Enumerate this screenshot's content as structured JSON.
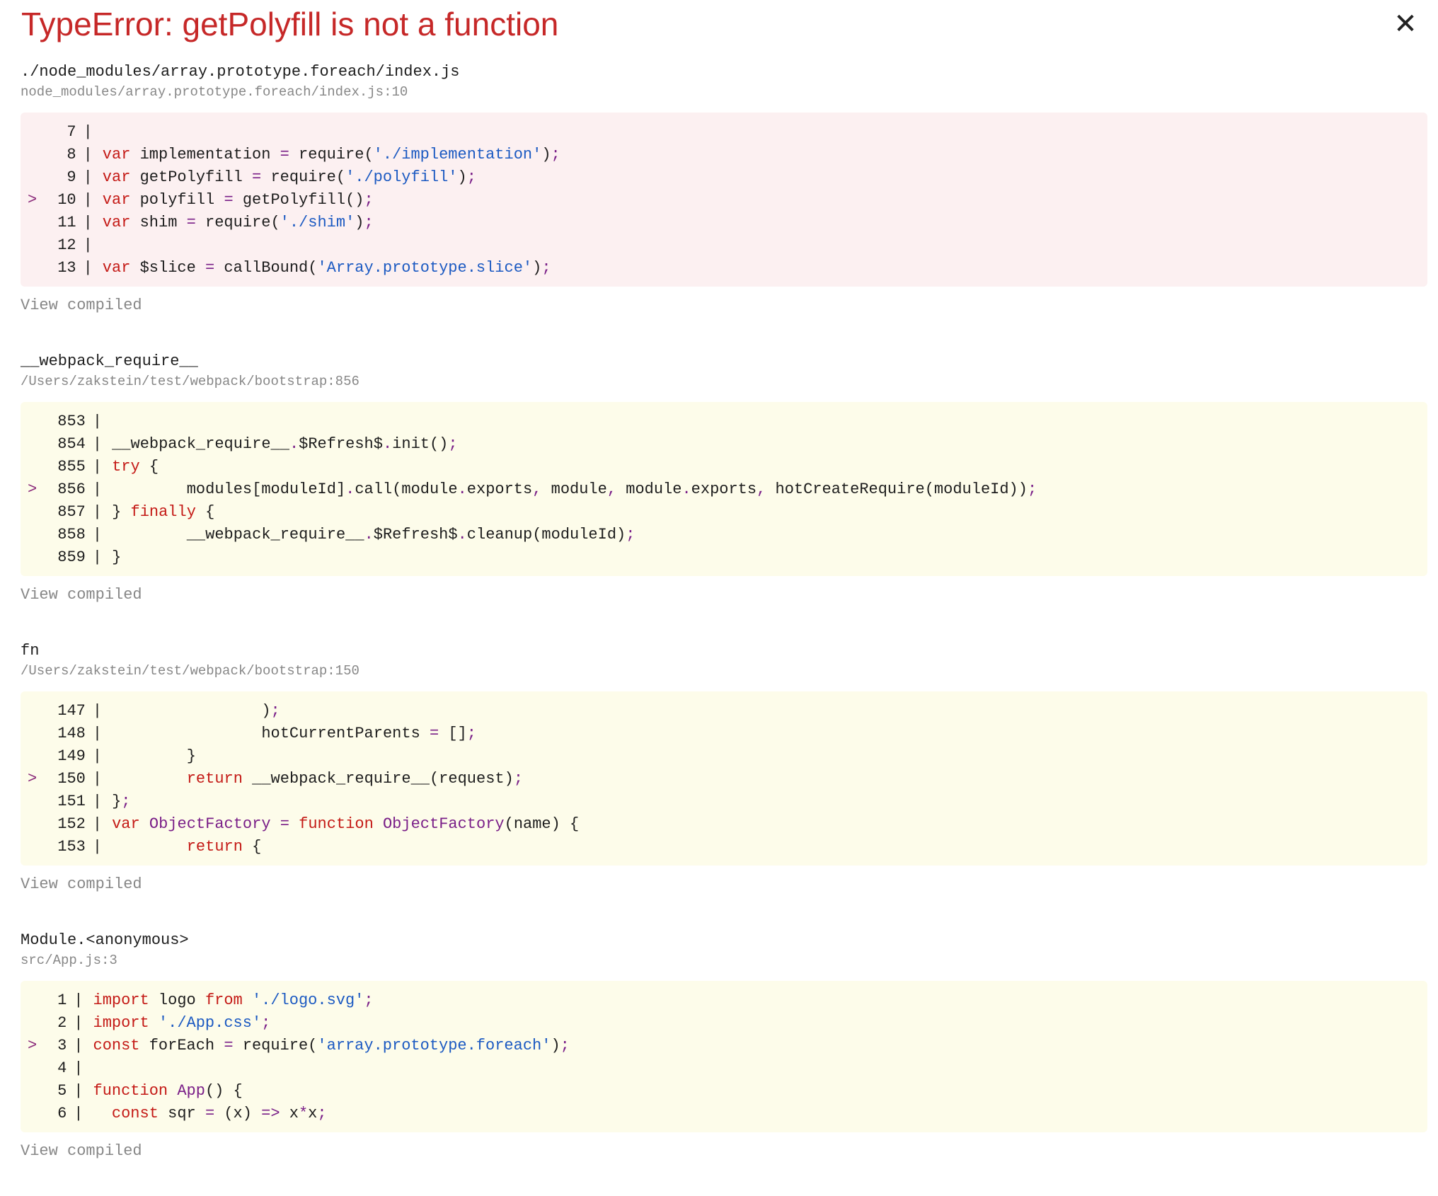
{
  "error": {
    "title": "TypeError: getPolyfill is not a function",
    "close_glyph": "✕"
  },
  "frames": [
    {
      "function": "./node_modules/array.prototype.foreach/index.js",
      "location": "node_modules/array.prototype.foreach/index.js:10",
      "style": "error",
      "view_compiled": "View compiled",
      "lines": [
        {
          "marker": "",
          "num": "7",
          "tokens": []
        },
        {
          "marker": "",
          "num": "8",
          "tokens": [
            [
              "kw",
              "var"
            ],
            [
              "txt",
              " implementation "
            ],
            [
              "punc",
              "="
            ],
            [
              "txt",
              " require("
            ],
            [
              "str",
              "'./implementation'"
            ],
            [
              "txt",
              ")"
            ],
            [
              "punc",
              ";"
            ]
          ]
        },
        {
          "marker": "",
          "num": "9",
          "tokens": [
            [
              "kw",
              "var"
            ],
            [
              "txt",
              " getPolyfill "
            ],
            [
              "punc",
              "="
            ],
            [
              "txt",
              " require("
            ],
            [
              "str",
              "'./polyfill'"
            ],
            [
              "txt",
              ")"
            ],
            [
              "punc",
              ";"
            ]
          ]
        },
        {
          "marker": ">",
          "num": "10",
          "tokens": [
            [
              "kw",
              "var"
            ],
            [
              "txt",
              " polyfill "
            ],
            [
              "punc",
              "="
            ],
            [
              "txt",
              " getPolyfill()"
            ],
            [
              "punc",
              ";"
            ]
          ]
        },
        {
          "marker": "",
          "num": "11",
          "tokens": [
            [
              "kw",
              "var"
            ],
            [
              "txt",
              " shim "
            ],
            [
              "punc",
              "="
            ],
            [
              "txt",
              " require("
            ],
            [
              "str",
              "'./shim'"
            ],
            [
              "txt",
              ")"
            ],
            [
              "punc",
              ";"
            ]
          ]
        },
        {
          "marker": "",
          "num": "12",
          "tokens": []
        },
        {
          "marker": "",
          "num": "13",
          "tokens": [
            [
              "kw",
              "var"
            ],
            [
              "txt",
              " $slice "
            ],
            [
              "punc",
              "="
            ],
            [
              "txt",
              " callBound("
            ],
            [
              "str",
              "'Array.prototype.slice'"
            ],
            [
              "txt",
              ")"
            ],
            [
              "punc",
              ";"
            ]
          ]
        }
      ]
    },
    {
      "function": "__webpack_require__",
      "location": "/Users/zakstein/test/webpack/bootstrap:856",
      "style": "warn",
      "view_compiled": "View compiled",
      "lines": [
        {
          "marker": "",
          "num": "853",
          "tokens": []
        },
        {
          "marker": "",
          "num": "854",
          "tokens": [
            [
              "txt",
              "__webpack_require__"
            ],
            [
              "punc",
              "."
            ],
            [
              "txt",
              "$Refresh$"
            ],
            [
              "punc",
              "."
            ],
            [
              "txt",
              "init()"
            ],
            [
              "punc",
              ";"
            ]
          ]
        },
        {
          "marker": "",
          "num": "855",
          "tokens": [
            [
              "kw",
              "try"
            ],
            [
              "txt",
              " {"
            ]
          ]
        },
        {
          "marker": ">",
          "num": "856",
          "tokens": [
            [
              "txt",
              "        modules[moduleId]"
            ],
            [
              "punc",
              "."
            ],
            [
              "txt",
              "call(module"
            ],
            [
              "punc",
              "."
            ],
            [
              "txt",
              "exports"
            ],
            [
              "punc",
              ","
            ],
            [
              "txt",
              " module"
            ],
            [
              "punc",
              ","
            ],
            [
              "txt",
              " module"
            ],
            [
              "punc",
              "."
            ],
            [
              "txt",
              "exports"
            ],
            [
              "punc",
              ","
            ],
            [
              "txt",
              " hotCreateRequire(moduleId))"
            ],
            [
              "punc",
              ";"
            ]
          ]
        },
        {
          "marker": "",
          "num": "857",
          "tokens": [
            [
              "txt",
              "} "
            ],
            [
              "kw",
              "finally"
            ],
            [
              "txt",
              " {"
            ]
          ]
        },
        {
          "marker": "",
          "num": "858",
          "tokens": [
            [
              "txt",
              "        __webpack_require__"
            ],
            [
              "punc",
              "."
            ],
            [
              "txt",
              "$Refresh$"
            ],
            [
              "punc",
              "."
            ],
            [
              "txt",
              "cleanup(moduleId)"
            ],
            [
              "punc",
              ";"
            ]
          ]
        },
        {
          "marker": "",
          "num": "859",
          "tokens": [
            [
              "txt",
              "}"
            ]
          ]
        }
      ]
    },
    {
      "function": "fn",
      "location": "/Users/zakstein/test/webpack/bootstrap:150",
      "style": "warn",
      "view_compiled": "View compiled",
      "lines": [
        {
          "marker": "",
          "num": "147",
          "tokens": [
            [
              "txt",
              "                )"
            ],
            [
              "punc",
              ";"
            ]
          ]
        },
        {
          "marker": "",
          "num": "148",
          "tokens": [
            [
              "txt",
              "                hotCurrentParents "
            ],
            [
              "punc",
              "="
            ],
            [
              "txt",
              " []"
            ],
            [
              "punc",
              ";"
            ]
          ]
        },
        {
          "marker": "",
          "num": "149",
          "tokens": [
            [
              "txt",
              "        }"
            ]
          ]
        },
        {
          "marker": ">",
          "num": "150",
          "tokens": [
            [
              "txt",
              "        "
            ],
            [
              "kw",
              "return"
            ],
            [
              "txt",
              " __webpack_require__(request)"
            ],
            [
              "punc",
              ";"
            ]
          ]
        },
        {
          "marker": "",
          "num": "151",
          "tokens": [
            [
              "txt",
              "}"
            ],
            [
              "punc",
              ";"
            ]
          ]
        },
        {
          "marker": "",
          "num": "152",
          "tokens": [
            [
              "kw",
              "var"
            ],
            [
              "fnm",
              " ObjectFactory"
            ],
            [
              "txt",
              " "
            ],
            [
              "punc",
              "="
            ],
            [
              "txt",
              " "
            ],
            [
              "kw",
              "function"
            ],
            [
              "fnm",
              " ObjectFactory"
            ],
            [
              "txt",
              "(name) {"
            ]
          ]
        },
        {
          "marker": "",
          "num": "153",
          "tokens": [
            [
              "txt",
              "        "
            ],
            [
              "kw",
              "return"
            ],
            [
              "txt",
              " {"
            ]
          ]
        }
      ]
    },
    {
      "function": "Module.<anonymous>",
      "location": "src/App.js:3",
      "style": "warn",
      "view_compiled": "View compiled",
      "lines": [
        {
          "marker": "",
          "num": "1",
          "tokens": [
            [
              "kw",
              "import"
            ],
            [
              "txt",
              " logo "
            ],
            [
              "kw",
              "from"
            ],
            [
              "txt",
              " "
            ],
            [
              "str",
              "'./logo.svg'"
            ],
            [
              "punc",
              ";"
            ]
          ]
        },
        {
          "marker": "",
          "num": "2",
          "tokens": [
            [
              "kw",
              "import"
            ],
            [
              "txt",
              " "
            ],
            [
              "str",
              "'./App.css'"
            ],
            [
              "punc",
              ";"
            ]
          ]
        },
        {
          "marker": ">",
          "num": "3",
          "tokens": [
            [
              "kw",
              "const"
            ],
            [
              "txt",
              " forEach "
            ],
            [
              "punc",
              "="
            ],
            [
              "txt",
              " require("
            ],
            [
              "str",
              "'array.prototype.foreach'"
            ],
            [
              "txt",
              ")"
            ],
            [
              "punc",
              ";"
            ]
          ]
        },
        {
          "marker": "",
          "num": "4",
          "tokens": []
        },
        {
          "marker": "",
          "num": "5",
          "tokens": [
            [
              "kw",
              "function"
            ],
            [
              "fnm",
              " App"
            ],
            [
              "txt",
              "() {"
            ]
          ]
        },
        {
          "marker": "",
          "num": "6",
          "tokens": [
            [
              "txt",
              "  "
            ],
            [
              "kw",
              "const"
            ],
            [
              "txt",
              " sqr "
            ],
            [
              "punc",
              "="
            ],
            [
              "txt",
              " (x) "
            ],
            [
              "punc",
              "=>"
            ],
            [
              "txt",
              " x"
            ],
            [
              "punc",
              "*"
            ],
            [
              "txt",
              "x"
            ],
            [
              "punc",
              ";"
            ]
          ]
        }
      ]
    }
  ],
  "colors": {
    "title": "#c62828",
    "error_frame_bg": "#fcf0f1",
    "frame_bg": "#fdfcea",
    "keyword": "#c41a16",
    "string": "#1c5ac2",
    "punctuation": "#7a1f88",
    "muted": "#878787"
  }
}
